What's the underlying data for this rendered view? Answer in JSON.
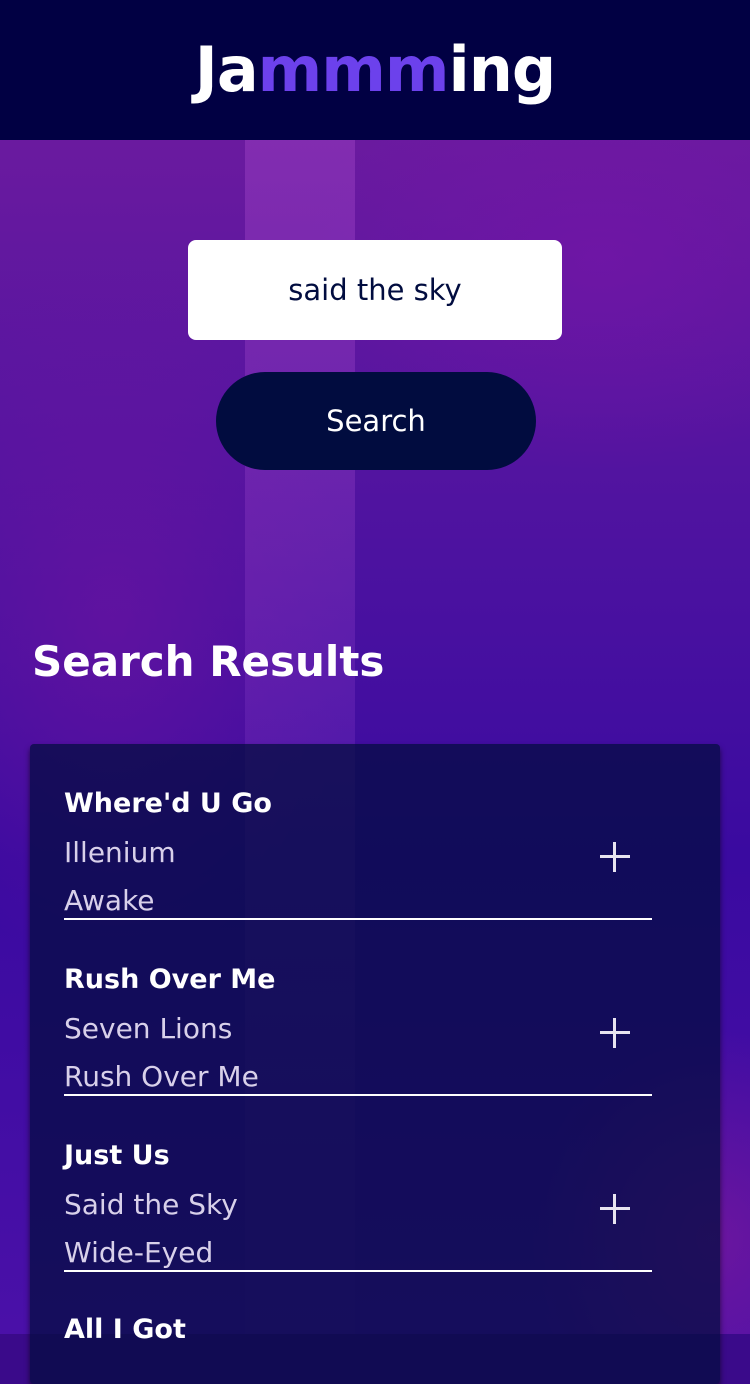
{
  "app": {
    "title_parts": [
      "Ja",
      "mmm",
      "ing"
    ]
  },
  "search": {
    "value": "said the sky",
    "button_label": "Search"
  },
  "results": {
    "heading": "Search Results",
    "tracks": [
      {
        "name": "Where'd U Go",
        "artist": "Illenium",
        "album": "Awake"
      },
      {
        "name": "Rush Over Me",
        "artist": "Seven Lions",
        "album": "Rush Over Me"
      },
      {
        "name": "Just Us",
        "artist": "Said the Sky",
        "album": "Wide-Eyed"
      },
      {
        "name": "All I Got",
        "artist": "",
        "album": ""
      }
    ],
    "add_icon": "plus-icon"
  },
  "colors": {
    "header_bg": "#010043",
    "accent": "#6c41ec",
    "button_bg": "#010c3f"
  }
}
